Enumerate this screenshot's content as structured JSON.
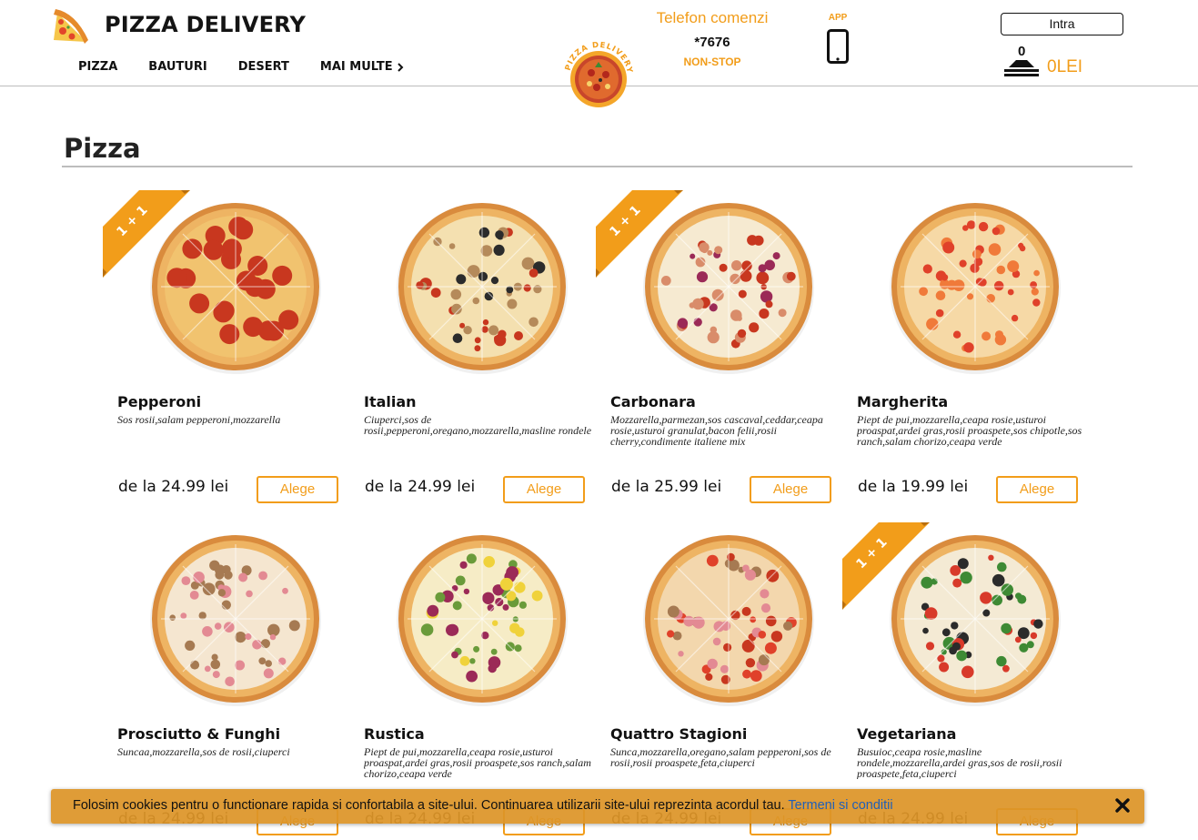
{
  "header": {
    "brand_title": "PIZZA DELIVERY",
    "nav": [
      {
        "label": "PIZZA"
      },
      {
        "label": "BAUTURI"
      },
      {
        "label": "DESERT"
      },
      {
        "label": "MAI MULTE"
      }
    ],
    "badge_text": "PIZZA DELIVERY",
    "phone_label": "Telefon comenzi",
    "phone_number": "*7676",
    "phone_nonstop": "NON-STOP",
    "app_label": "APP",
    "login_label": "Intra",
    "cart_count": "0",
    "cart_total": "0LEI"
  },
  "section": {
    "title": "Pizza"
  },
  "products": [
    {
      "name": "Pepperoni",
      "desc": "Sos rosii,salam pepperoni,mozzarella",
      "price": "de la 24.99 lei",
      "button": "Alege",
      "promo": "1 + 1",
      "topping": "pepperoni"
    },
    {
      "name": "Italian",
      "desc": "Ciuperci,sos de rosii,pepperoni,oregano,mozzarella,masline rondele",
      "price": "de la 24.99 lei",
      "button": "Alege",
      "promo": "",
      "topping": "italian"
    },
    {
      "name": "Carbonara",
      "desc": "Mozzarella,parmezan,sos cascaval,ceddar,ceapa rosie,usturoi granulat,bacon felii,rosii cherry,condimente italiene mix",
      "price": "de la 25.99 lei",
      "button": "Alege",
      "promo": "1 + 1",
      "topping": "carbonara"
    },
    {
      "name": "Margherita",
      "desc": "Piept de pui,mozzarella,ceapa rosie,usturoi proaspat,ardei gras,rosii proaspete,sos chipotle,sos ranch,salam chorizo,ceapa verde",
      "price": "de la 19.99 lei",
      "button": "Alege",
      "promo": "",
      "topping": "margherita"
    },
    {
      "name": "Prosciutto & Funghi",
      "desc": "Suncaa,mozzarella,sos de rosii,ciuperci",
      "price": "de la 24.99 lei",
      "button": "Alege",
      "promo": "",
      "topping": "prosciutto"
    },
    {
      "name": "Rustica",
      "desc": "Piept de pui,mozzarella,ceapa rosie,usturoi proaspat,ardei gras,rosii proaspete,sos ranch,salam chorizo,ceapa verde",
      "price": "de la 24.99 lei",
      "button": "Alege",
      "promo": "",
      "topping": "rustica"
    },
    {
      "name": "Quattro Stagioni",
      "desc": "Sunca,mozzarella,oregano,salam pepperoni,sos de rosii,rosii proaspete,feta,ciuperci",
      "price": "de la 24.99 lei",
      "button": "Alege",
      "promo": "",
      "topping": "quattro"
    },
    {
      "name": "Vegetariana",
      "desc": "Busuioc,ceapa rosie,masline rondele,mozzarella,ardei gras,sos de rosii,rosii proaspete,feta,ciuperci",
      "price": "de la 24.99 lei",
      "button": "Alege",
      "promo": "1 + 1",
      "topping": "vegetariana"
    }
  ],
  "cookie": {
    "text": "Folosim cookies pentru o functionare rapida si confortabila a site-ului. Continuarea utilizarii site-ului reprezinta acordul tau.",
    "link": "Termeni si conditii"
  },
  "colors": {
    "accent": "#f29d1a",
    "text": "#111111",
    "divider": "#bdbdbd",
    "cookie_bg": "#dd9428",
    "link": "#1f5fb8"
  },
  "icons": [
    "pizza-slice-icon",
    "chevron-right-icon",
    "pizza-badge-icon",
    "smartphone-icon",
    "cart-icon",
    "close-icon"
  ]
}
